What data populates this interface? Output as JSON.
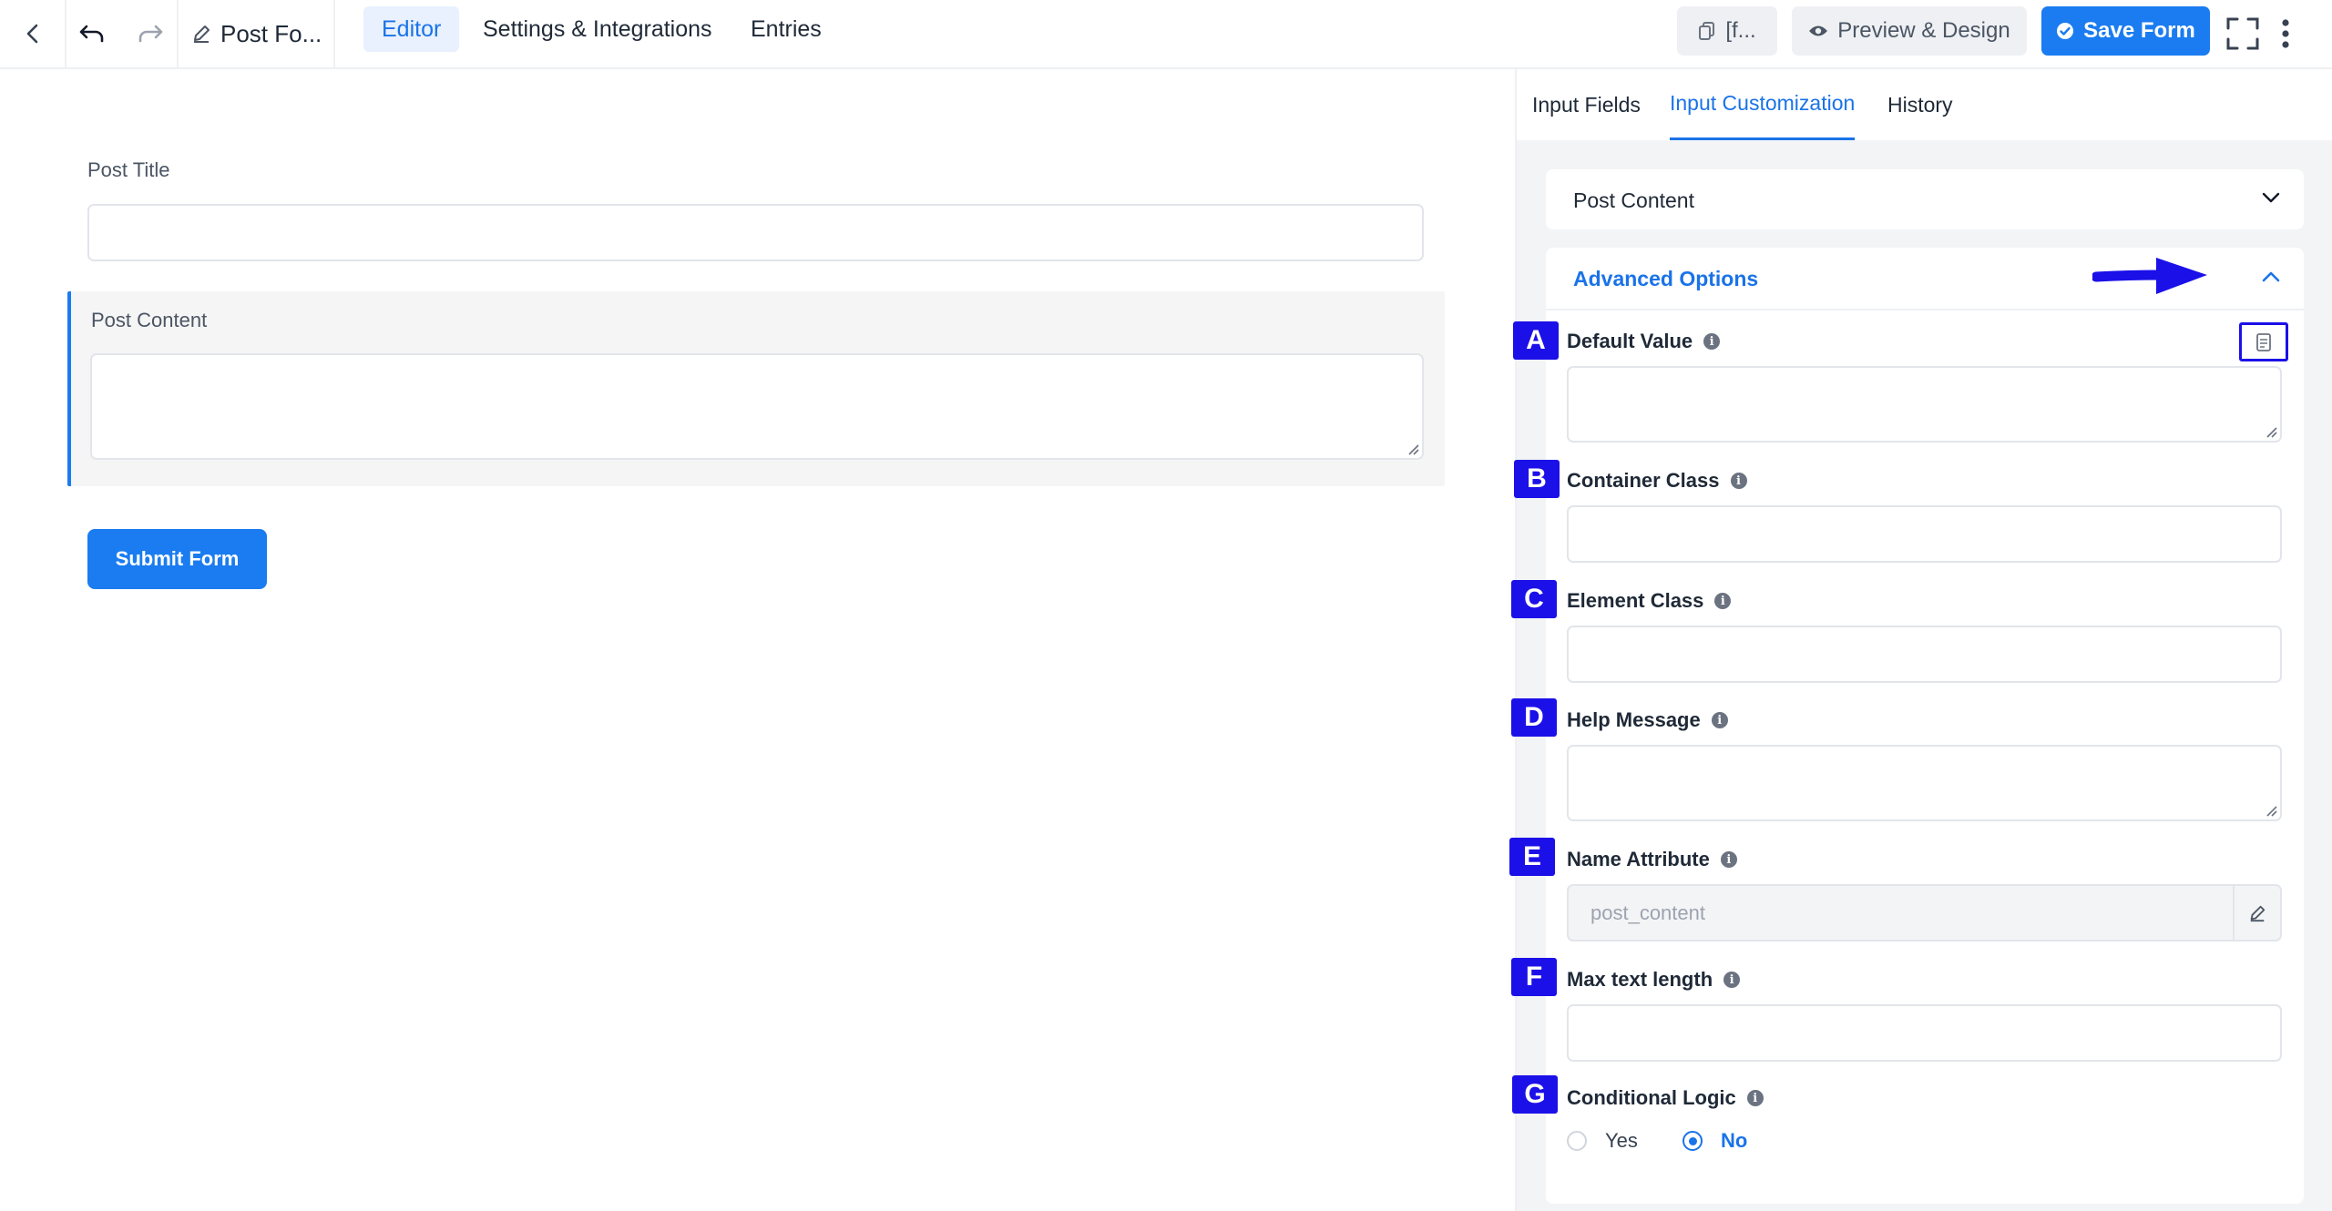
{
  "topbar": {
    "form_title": "Post Fo...",
    "tabs": [
      {
        "label": "Editor",
        "active": true
      },
      {
        "label": "Settings & Integrations",
        "active": false
      },
      {
        "label": "Entries",
        "active": false
      }
    ],
    "shortcode_label": "[f...",
    "preview_label": "Preview & Design",
    "save_label": "Save Form"
  },
  "editor": {
    "fields": [
      {
        "label": "Post Title",
        "type": "text"
      },
      {
        "label": "Post Content",
        "type": "textarea",
        "selected": true
      }
    ],
    "submit_label": "Submit Form"
  },
  "panel": {
    "tabs": [
      {
        "label": "Input Fields",
        "active": false
      },
      {
        "label": "Input Customization",
        "active": true
      },
      {
        "label": "History",
        "active": false
      }
    ],
    "field_section_title": "Post Content",
    "advanced_title": "Advanced Options",
    "options": [
      {
        "marker": "A",
        "label": "Default Value",
        "value": ""
      },
      {
        "marker": "B",
        "label": "Container Class",
        "value": ""
      },
      {
        "marker": "C",
        "label": "Element Class",
        "value": ""
      },
      {
        "marker": "D",
        "label": "Help Message",
        "value": ""
      },
      {
        "marker": "E",
        "label": "Name Attribute",
        "value": "post_content"
      },
      {
        "marker": "F",
        "label": "Max text length",
        "value": ""
      },
      {
        "marker": "G",
        "label": "Conditional Logic"
      }
    ],
    "conditional_logic": {
      "yes_label": "Yes",
      "no_label": "No",
      "selected": "No"
    }
  },
  "colors": {
    "accent": "#1a7cf0",
    "annotation": "#1b10e8"
  }
}
